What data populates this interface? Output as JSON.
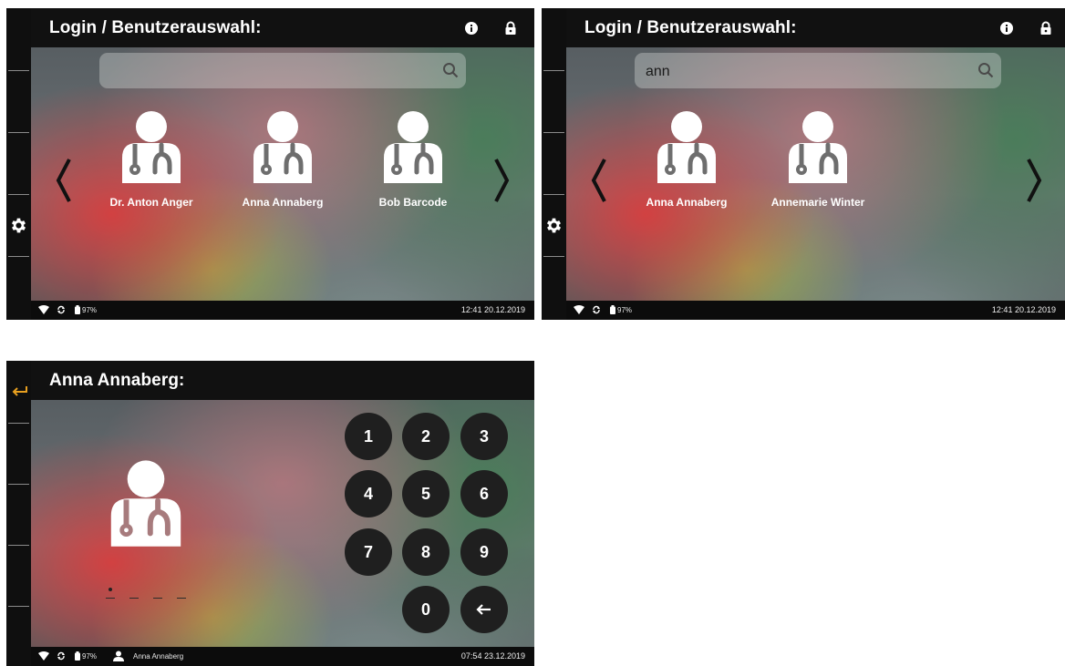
{
  "screen1": {
    "title": "Login / Benutzerauswahl:",
    "search": {
      "value": "",
      "placeholder": ""
    },
    "users": [
      "Dr. Anton Anger",
      "Anna Annaberg",
      "Bob Barcode"
    ],
    "status": {
      "battery": "97%",
      "datetime": "12:41 20.12.2019"
    }
  },
  "screen2": {
    "title": "Login / Benutzerauswahl:",
    "search": {
      "value": "ann",
      "placeholder": ""
    },
    "users": [
      "Anna Annaberg",
      "Annemarie Winter"
    ],
    "status": {
      "battery": "97%",
      "datetime": "12:41 20.12.2019"
    }
  },
  "screen3": {
    "title": "Anna Annaberg:",
    "keypad": [
      "1",
      "2",
      "3",
      "4",
      "5",
      "6",
      "7",
      "8",
      "9",
      "0"
    ],
    "status": {
      "battery": "97%",
      "user": "Anna Annaberg",
      "datetime": "07:54 23.12.2019"
    }
  },
  "colors": {
    "back_arrow": "#e8a020",
    "topbar": "#111111",
    "key": "#1f1f1f"
  },
  "icons": [
    "info-icon",
    "lock-icon",
    "search-icon",
    "gear-icon",
    "chevron-left-icon",
    "chevron-right-icon",
    "doctor-icon",
    "wifi-icon",
    "sync-icon",
    "battery-icon",
    "user-icon",
    "back-arrow-icon",
    "backspace-icon"
  ]
}
